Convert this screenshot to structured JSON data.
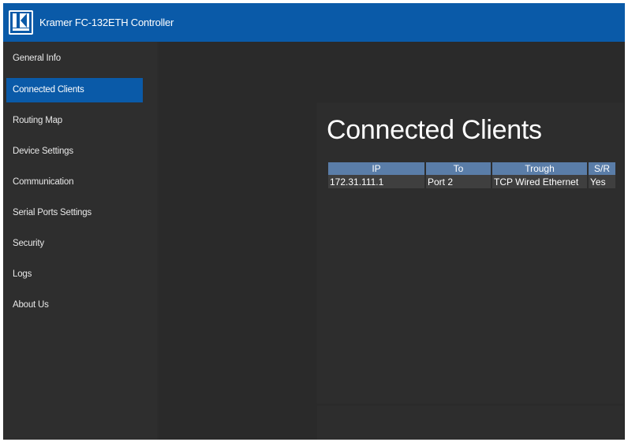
{
  "app": {
    "title": "Kramer FC-132ETH Controller",
    "logo": "kramer-logo"
  },
  "sidebar": {
    "items": [
      {
        "label": "General Info"
      },
      {
        "label": "Connected Clients",
        "active": true
      },
      {
        "label": "Routing Map"
      },
      {
        "label": "Device Settings"
      },
      {
        "label": "Communication"
      },
      {
        "label": "Serial Ports Settings"
      },
      {
        "label": "Security"
      },
      {
        "label": "Logs"
      },
      {
        "label": "About Us"
      }
    ]
  },
  "main": {
    "title": "Connected Clients",
    "table": {
      "headers": [
        "IP",
        "To",
        "Trough",
        "S/R"
      ],
      "rows": [
        [
          "172.31.111.1",
          "Port 2",
          "TCP Wired Ethernet",
          "Yes"
        ]
      ]
    }
  },
  "colors": {
    "brand": "#0a5aa8",
    "header_cell": "#5a7da8",
    "background": "#2c2c2c"
  }
}
